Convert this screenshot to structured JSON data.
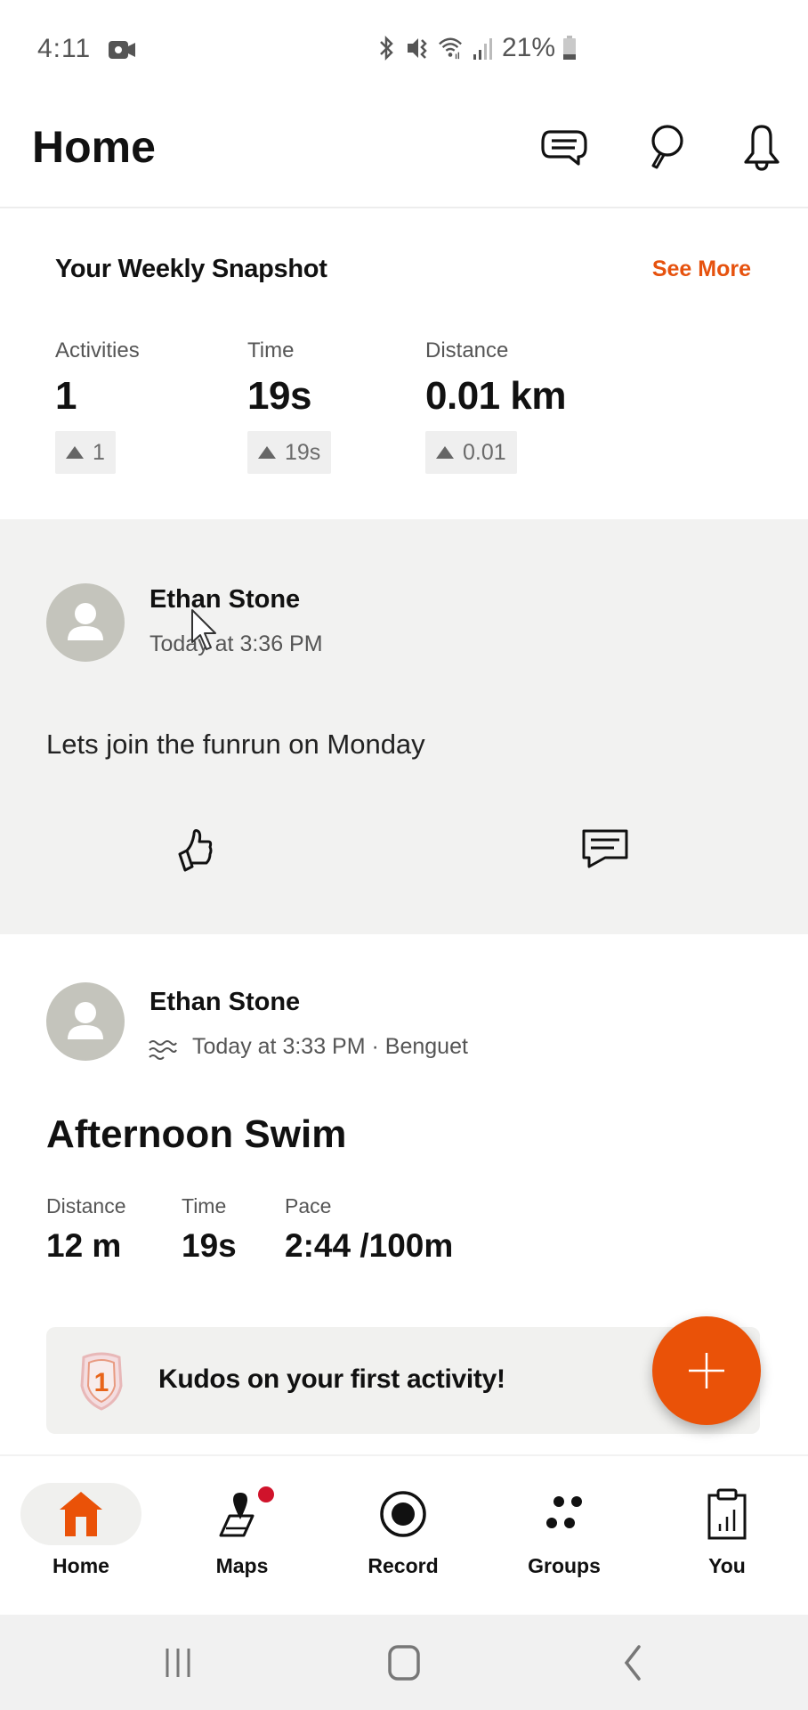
{
  "status_bar": {
    "time": "4:11",
    "battery": "21%",
    "icons": [
      "screen-record-icon",
      "bluetooth-icon",
      "vibrate-mute-icon",
      "wifi-icon",
      "signal-icon",
      "battery-icon"
    ]
  },
  "header": {
    "title": "Home",
    "icons": [
      "messages-icon",
      "search-icon",
      "notifications-icon"
    ]
  },
  "snapshot": {
    "title": "Your Weekly Snapshot",
    "see_more": "See More",
    "stats": [
      {
        "label": "Activities",
        "value": "1",
        "delta": "1"
      },
      {
        "label": "Time",
        "value": "19s",
        "delta": "19s"
      },
      {
        "label": "Distance",
        "value": "0.01 km",
        "delta": "0.01"
      }
    ]
  },
  "post": {
    "author": "Ethan Stone",
    "timestamp": "Today at 3:36 PM",
    "text": "Lets join the funrun on Monday",
    "actions": [
      "like-icon",
      "comment-icon"
    ]
  },
  "activity": {
    "author": "Ethan Stone",
    "sport_icon": "swim-icon",
    "meta": "Today at 3:33 PM · Benguet",
    "title": "Afternoon Swim",
    "stats": [
      {
        "label": "Distance",
        "value": "12 m"
      },
      {
        "label": "Time",
        "value": "19s"
      },
      {
        "label": "Pace",
        "value": "2:44 /100m"
      }
    ],
    "kudos_text": "Kudos on your first activity!",
    "kudos_badge_number": "1"
  },
  "fab": {
    "icon": "plus-icon"
  },
  "bottom_nav": {
    "active": "Home",
    "items": [
      {
        "label": "Home",
        "icon": "home-icon"
      },
      {
        "label": "Maps",
        "icon": "maps-icon",
        "badge": true
      },
      {
        "label": "Record",
        "icon": "record-icon"
      },
      {
        "label": "Groups",
        "icon": "groups-icon"
      },
      {
        "label": "You",
        "icon": "you-icon"
      }
    ]
  },
  "colors": {
    "accent": "#ea5208",
    "link": "#e6520e",
    "badge": "#d0132b",
    "feed_bg": "#f2f2f1"
  }
}
